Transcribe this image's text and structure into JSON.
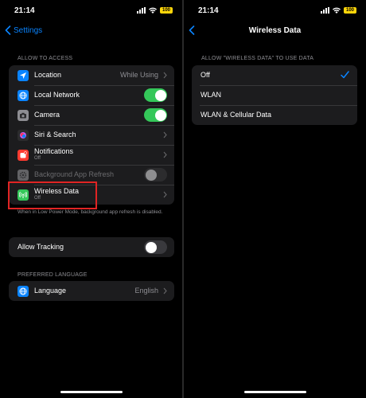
{
  "status": {
    "time": "21:14",
    "battery": "100"
  },
  "left": {
    "back_label": "Settings",
    "allow_header": "ALLOW                    TO ACCESS",
    "rows": [
      {
        "label": "Location",
        "value": "While Using"
      },
      {
        "label": "Local Network",
        "toggle": "on"
      },
      {
        "label": "Camera",
        "toggle": "on"
      },
      {
        "label": "Siri & Search"
      },
      {
        "label": "Notifications",
        "subtitle": "Off"
      },
      {
        "label": "Background App Refresh",
        "toggle": "off",
        "disabled": true
      },
      {
        "label": "Wireless Data",
        "subtitle": "Off"
      }
    ],
    "footnote": "When in Low Power Mode, background app refresh is disabled.",
    "tracking_label": "Allow Tracking",
    "tracking_toggle": "off",
    "language_header": "PREFERRED LANGUAGE",
    "language_label": "Language",
    "language_value": "English",
    "colors": {
      "location": "#0a84ff",
      "local_network": "#0a84ff",
      "camera": "#8e8e93",
      "siri": "#2c2c2e",
      "notifications": "#ff3b30",
      "background_refresh": "#636366",
      "wireless": "#34c759",
      "language": "#0a84ff",
      "highlight": "#e02424"
    }
  },
  "right": {
    "title": "Wireless Data",
    "header": "ALLOW \"WIRELESS DATA\" TO USE DATA",
    "options": [
      {
        "label": "Off",
        "selected": true
      },
      {
        "label": "WLAN",
        "selected": false
      },
      {
        "label": "WLAN & Cellular Data",
        "selected": false
      }
    ]
  }
}
